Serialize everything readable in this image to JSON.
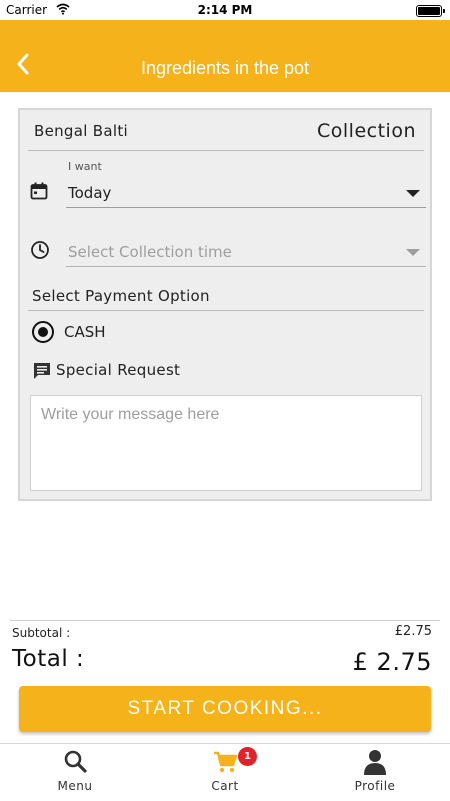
{
  "status_bar": {
    "carrier": "Carrier",
    "time": "2:14 PM"
  },
  "header": {
    "title": "Ingredients in the pot",
    "back_icon": "chevron-left-icon"
  },
  "order": {
    "restaurant": "Bengal Balti",
    "mode": "Collection",
    "i_want_label": "I want",
    "day_value": "Today",
    "time_placeholder": "Select Collection time",
    "payment_label": "Select Payment Option",
    "payment_option": "CASH",
    "special_request_label": "Special Request",
    "message_placeholder": "Write your message here"
  },
  "totals": {
    "subtotal_label": "Subtotal :",
    "subtotal_value": "£2.75",
    "total_label": "Total :",
    "total_value": "£ 2.75"
  },
  "action": {
    "start_label": "START COOKING..."
  },
  "tabbar": {
    "menu_label": "Menu",
    "cart_label": "Cart",
    "cart_badge": "1",
    "profile_label": "Profile"
  },
  "colors": {
    "accent": "#F5B21B",
    "badge": "#e0222a",
    "card_bg": "#eeeeee"
  }
}
